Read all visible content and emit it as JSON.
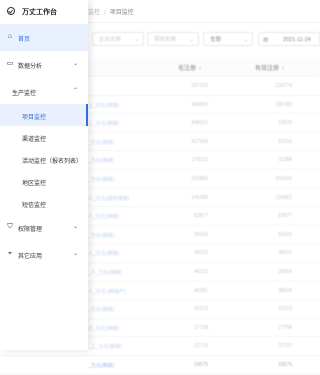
{
  "app": {
    "title": "万丈工作台"
  },
  "breadcrumb": {
    "parent": "监控",
    "sep": "/",
    "current": "项目监控"
  },
  "filters": {
    "company_placeholder": "企业名称",
    "project_placeholder": "项目名称",
    "status_value": "全部",
    "date_value": "2021-11-24"
  },
  "table": {
    "headers": {
      "col1": "毛注册",
      "col2": "有效注册"
    },
    "rows": [
      {
        "name": "",
        "v1": "287160",
        "v2": "226774"
      },
      {
        "name": "上_万元(换链)",
        "v1": "394802",
        "v2": "290788"
      },
      {
        "name": "三_万元(换链)",
        "v1": "448151",
        "v2": "23826"
      },
      {
        "name": "_万元(换链)",
        "v1": "417366",
        "v2": "90316"
      },
      {
        "name": "_万元(换链)",
        "v1": "278111",
        "v2": "11388"
      },
      {
        "name": "_万元(换链)",
        "v1": "205866",
        "v2": "204692"
      },
      {
        "name": "人_万元(插件插链)",
        "v1": "146389",
        "v2": "134881"
      },
      {
        "name": "人_万元(换链)",
        "v1": "82877",
        "v2": "82877"
      },
      {
        "name": "_万元(换链)",
        "v1": "56626",
        "v2": "56523"
      },
      {
        "name": "人_万元(换链)",
        "v1": "48311",
        "v2": "48311"
      },
      {
        "name": "_人_万元(换链)",
        "v1": "46161",
        "v2": "28604"
      },
      {
        "name": "人_万元 (换链产)",
        "v1": "46281",
        "v2": "38604"
      },
      {
        "name": "_万元(换链)",
        "v1": "37013",
        "v2": "37013"
      },
      {
        "name": "万_万元(换链)",
        "v1": "27798",
        "v2": "27798"
      },
      {
        "name": "_上_万元(换链)",
        "v1": "22710",
        "v2": "22710"
      },
      {
        "name": "_万元(换链)",
        "v1": "19575",
        "v2": "19575"
      }
    ]
  },
  "sidebar": {
    "home": "首页",
    "analysis": "数据分析",
    "production": "生产监控",
    "sub_items": [
      "项目监控",
      "渠道监控",
      "活动监控（报名列表）",
      "地区监控",
      "短信监控"
    ],
    "permissions": "权限管理",
    "other": "其它应用"
  }
}
